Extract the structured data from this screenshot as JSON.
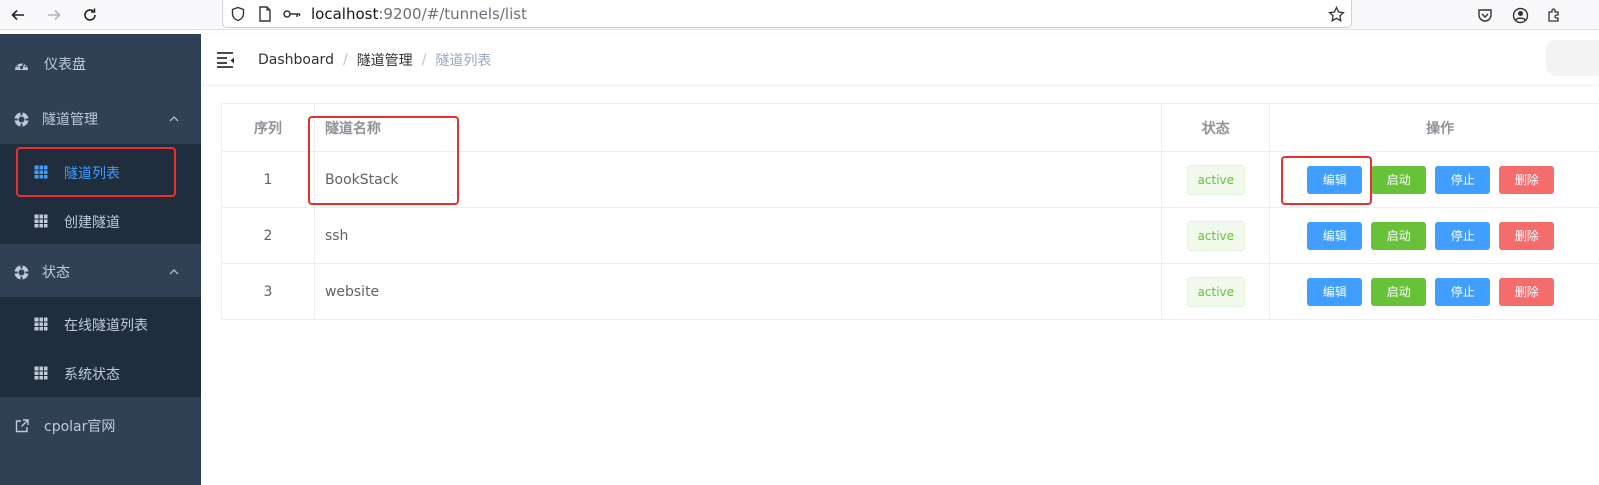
{
  "browser": {
    "url_host": "localhost",
    "url_rest": ":9200/#/tunnels/list",
    "back_icon": "arrow-left-icon",
    "forward_icon": "arrow-right-icon",
    "reload_icon": "reload-icon"
  },
  "sidebar": {
    "items": [
      {
        "label": "仪表盘",
        "icon": "dashboard-icon"
      },
      {
        "label": "隧道管理",
        "icon": "lifebuoy-icon",
        "expanded": true,
        "children": [
          {
            "label": "隧道列表",
            "icon": "table-grid-icon",
            "active": true
          },
          {
            "label": "创建隧道",
            "icon": "table-grid-icon"
          }
        ]
      },
      {
        "label": "状态",
        "icon": "lifebuoy-icon",
        "expanded": true,
        "children": [
          {
            "label": "在线隧道列表",
            "icon": "table-grid-icon"
          },
          {
            "label": "系统状态",
            "icon": "table-grid-icon"
          }
        ]
      },
      {
        "label": "cpolar官网",
        "icon": "external-link-icon"
      }
    ]
  },
  "breadcrumb": [
    "Dashboard",
    "隧道管理",
    "隧道列表"
  ],
  "table": {
    "headers": {
      "index": "序列",
      "name": "隧道名称",
      "status": "状态",
      "ops": "操作"
    },
    "rows": [
      {
        "index": "1",
        "name": "BookStack",
        "status": "active"
      },
      {
        "index": "2",
        "name": "ssh",
        "status": "active"
      },
      {
        "index": "3",
        "name": "website",
        "status": "active"
      }
    ],
    "actions": {
      "edit": "编辑",
      "start": "启动",
      "stop": "停止",
      "delete": "删除"
    }
  },
  "colors": {
    "sidebar_bg": "#304156",
    "submenu_bg": "#1f2d3d",
    "active_text": "#409eff",
    "primary": "#409eff",
    "success": "#67c23a",
    "danger": "#f56c6c",
    "annotation": "#e8302a"
  }
}
